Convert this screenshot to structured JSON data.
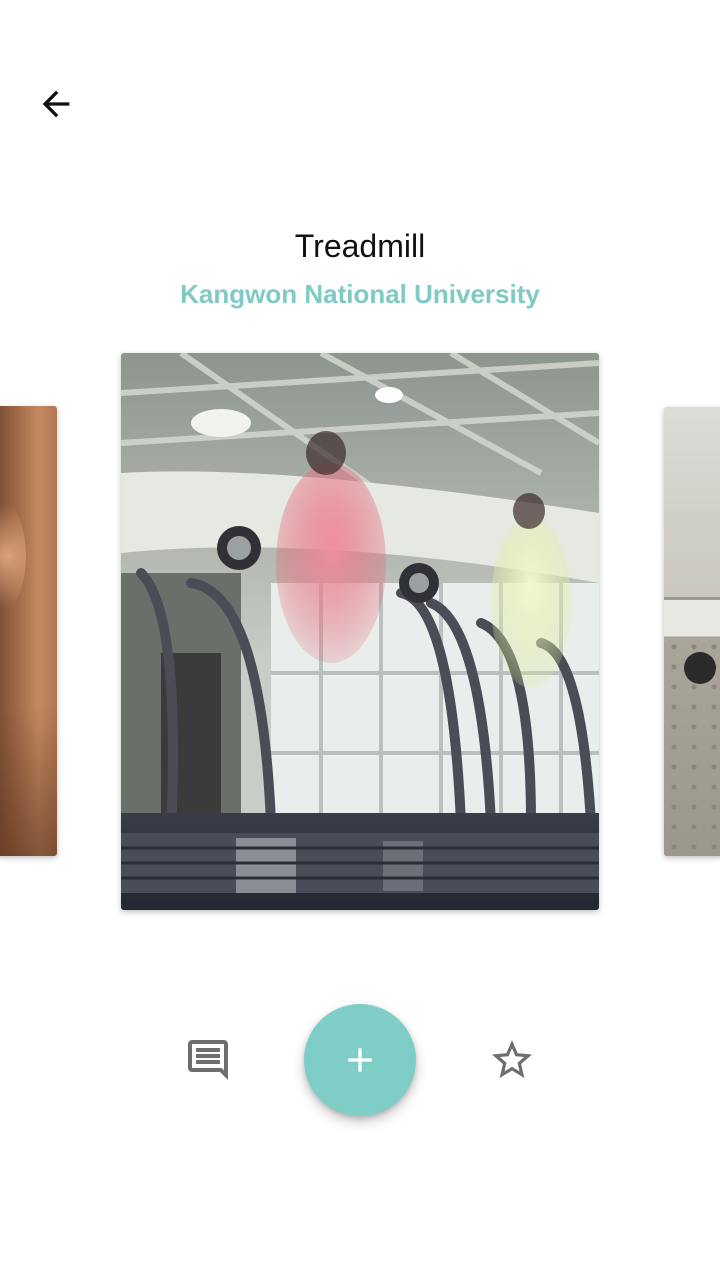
{
  "header": {
    "back_icon": "arrow-left-icon"
  },
  "item": {
    "title": "Treadmill",
    "location": "Kangwon National University"
  },
  "carousel": {
    "cards": [
      {
        "image": "person-portrait-photo"
      },
      {
        "image": "treadmill-gym-photo"
      },
      {
        "image": "outdoor-equipment-photo"
      }
    ]
  },
  "actions": {
    "comment_icon": "comment-icon",
    "add_icon": "plus-icon",
    "favorite_icon": "star-outline-icon"
  },
  "colors": {
    "accent": "#7fcdc7",
    "subtitle": "#7fcac4",
    "icon_gray": "#6e6e6e"
  }
}
